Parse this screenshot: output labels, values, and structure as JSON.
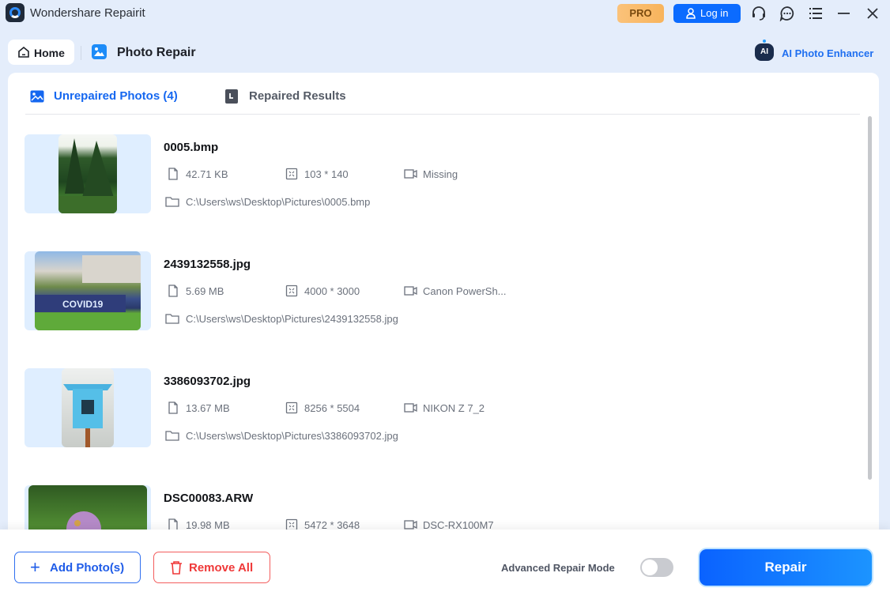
{
  "app": {
    "title": "Wondershare Repairit",
    "pro_label": "PRO",
    "login_label": "Log in"
  },
  "nav": {
    "home_label": "Home",
    "section_title": "Photo Repair",
    "ai_enhancer_label": "AI Photo Enhancer",
    "ai_icon_text": "AI"
  },
  "tabs": [
    {
      "label": "Unrepaired Photos (4)",
      "active": true
    },
    {
      "label": "Repaired Results",
      "active": false
    }
  ],
  "photos": [
    {
      "name": "0005.bmp",
      "size": "42.71 KB",
      "resolution": "103 * 140",
      "camera": "Missing",
      "path": "C:\\Users\\ws\\Desktop\\Pictures\\0005.bmp"
    },
    {
      "name": "2439132558.jpg",
      "size": "5.69 MB",
      "resolution": "4000 * 3000",
      "camera": "Canon PowerSh...",
      "path": "C:\\Users\\ws\\Desktop\\Pictures\\2439132558.jpg"
    },
    {
      "name": "3386093702.jpg",
      "size": "13.67 MB",
      "resolution": "8256 * 5504",
      "camera": "NIKON Z 7_2",
      "path": "C:\\Users\\ws\\Desktop\\Pictures\\3386093702.jpg"
    },
    {
      "name": "DSC00083.ARW",
      "size": "19.98 MB",
      "resolution": "5472 * 3648",
      "camera": "DSC-RX100M7",
      "path": ""
    }
  ],
  "footer": {
    "add_label": "Add Photo(s)",
    "remove_label": "Remove All",
    "advanced_label": "Advanced Repair Mode",
    "advanced_enabled": false,
    "repair_label": "Repair"
  },
  "colors": {
    "accent": "#1567f0",
    "danger": "#ef3838",
    "pro": "#f8b45c"
  }
}
